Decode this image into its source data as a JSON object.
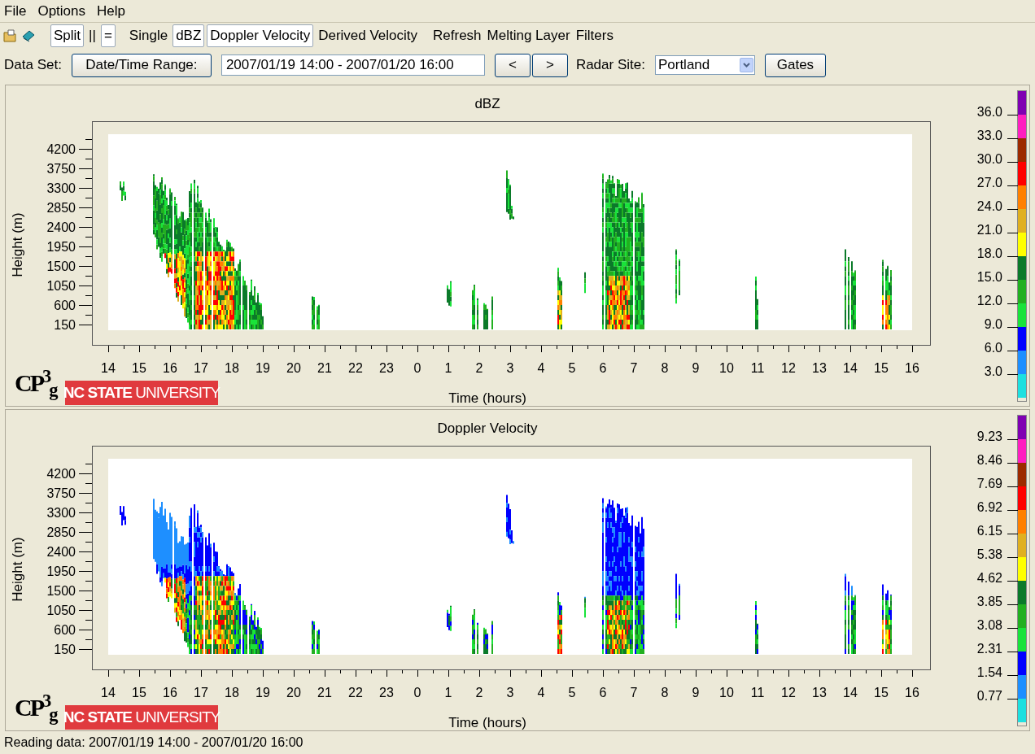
{
  "menu": [
    "File",
    "Options",
    "Help"
  ],
  "toolbar": {
    "groups": [
      [
        {
          "kind": "toggle",
          "label": "Split",
          "selected": true
        },
        {
          "kind": "toggle",
          "label": "||",
          "selected": false
        },
        {
          "kind": "toggle",
          "label": "=",
          "selected": true
        }
      ],
      [
        {
          "kind": "toggle",
          "label": "Single",
          "selected": false
        },
        {
          "kind": "toggle",
          "label": "dBZ",
          "selected": true
        },
        {
          "kind": "toggle",
          "label": "Doppler Velocity",
          "selected": true
        },
        {
          "kind": "toggle",
          "label": "Derived Velocity",
          "selected": false
        }
      ],
      [
        {
          "kind": "action",
          "label": "Refresh"
        },
        {
          "kind": "action",
          "label": "Melting Layer"
        },
        {
          "kind": "action",
          "label": "Filters"
        }
      ]
    ]
  },
  "dataset": {
    "label": "Data Set:",
    "range_button": "Date/Time Range:",
    "range_value": "2007/01/19 14:00 - 2007/01/20 16:00",
    "prev": "<",
    "next": ">",
    "site_label": "Radar Site:",
    "site": "Portland",
    "gates_button": "Gates"
  },
  "panels": [
    {
      "kind": "dbz",
      "title": "dBZ",
      "ylabel": "Height (m)",
      "xlabel": "Time (hours)",
      "yticks": [
        "4200",
        "3750",
        "3300",
        "2850",
        "2400",
        "1950",
        "1500",
        "1050",
        "600",
        "150"
      ],
      "xticks": [
        "14",
        "15",
        "16",
        "17",
        "18",
        "19",
        "20",
        "21",
        "22",
        "23",
        "0",
        "1",
        "2",
        "3",
        "4",
        "5",
        "6",
        "7",
        "8",
        "9",
        "10",
        "11",
        "12",
        "13",
        "14",
        "15",
        "16"
      ],
      "scale": {
        "labels": [
          "36.0",
          "33.0",
          "30.0",
          "27.0",
          "24.0",
          "21.0",
          "18.0",
          "15.0",
          "12.0",
          "9.0",
          "6.0",
          "3.0"
        ],
        "colors": [
          {
            "color": "#7f00b2"
          },
          {
            "color": "#ff1fc0"
          },
          {
            "color": "#9c2a00"
          },
          {
            "color": "#ff0000"
          },
          {
            "color": "#ff8000"
          },
          {
            "color": "#e0b020"
          },
          {
            "color": "#ffff00"
          },
          {
            "color": "#0b7a2a"
          },
          {
            "color": "#22b020"
          },
          {
            "color": "#19e33a"
          },
          {
            "color": "#0000ff"
          },
          {
            "color": "#1e8fff"
          },
          {
            "color": "#1ee0e0"
          }
        ]
      },
      "logo": {
        "mark": "CP$^{3}$$_{g}$",
        "banner": "**NC STATE** UNIVERSITY"
      }
    },
    {
      "kind": "velocity",
      "title": "Doppler Velocity",
      "ylabel": "Height (m)",
      "xlabel": "Time (hours)",
      "yticks": [
        "4200",
        "3750",
        "3300",
        "2850",
        "2400",
        "1950",
        "1500",
        "1050",
        "600",
        "150"
      ],
      "xticks": [
        "14",
        "15",
        "16",
        "17",
        "18",
        "19",
        "20",
        "21",
        "22",
        "23",
        "0",
        "1",
        "2",
        "3",
        "4",
        "5",
        "6",
        "7",
        "8",
        "9",
        "10",
        "11",
        "12",
        "13",
        "14",
        "15",
        "16"
      ],
      "scale": {
        "labels": [
          "9.23",
          "8.46",
          "7.69",
          "6.92",
          "6.15",
          "5.38",
          "4.62",
          "3.85",
          "3.08",
          "2.31",
          "1.54",
          "0.77"
        ],
        "colors": [
          {
            "color": "#7f00b2"
          },
          {
            "color": "#ff1fc0"
          },
          {
            "color": "#9c2a00"
          },
          {
            "color": "#ff0000"
          },
          {
            "color": "#ff8000"
          },
          {
            "color": "#e0b020"
          },
          {
            "color": "#ffff00"
          },
          {
            "color": "#0b7a2a"
          },
          {
            "color": "#22b020"
          },
          {
            "color": "#19e33a"
          },
          {
            "color": "#0000ff"
          },
          {
            "color": "#1e8fff"
          },
          {
            "color": "#1ee0e0"
          }
        ]
      },
      "logo": {
        "mark": "CP$^{3}$$_{g}$",
        "banner": "**NC STATE** UNIVERSITY"
      }
    }
  ],
  "status_bar": "Reading data: 2007/01/19 14:00 - 2007/01/20 16:00"
}
